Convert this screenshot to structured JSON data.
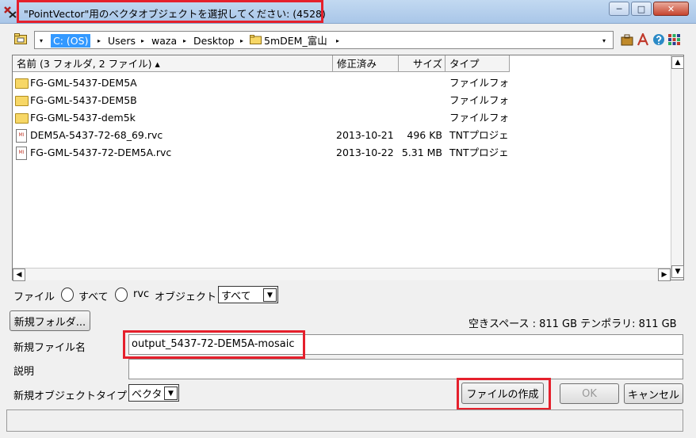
{
  "window": {
    "title": "\"PointVector\"用のベクタオブジェクトを選択してください: (4528)",
    "minimize_icon": "─",
    "maximize_icon": "□",
    "close_icon": "✕"
  },
  "address": {
    "crumbs": [
      "C: (OS)",
      "Users",
      "waza",
      "Desktop",
      "5mDEM_富山"
    ],
    "separator": "▸",
    "dropdown_icon": "▾"
  },
  "list": {
    "columns": {
      "name": "名前 (3 フォルダ, 2 ファイル) ▴",
      "modified": "修正済み",
      "size": "サイズ",
      "type": "タイプ"
    },
    "rows": [
      {
        "icon": "folder",
        "name": "FG-GML-5437-DEM5A",
        "modified": "",
        "size": "",
        "type": "ファイルフォ"
      },
      {
        "icon": "folder",
        "name": "FG-GML-5437-DEM5B",
        "modified": "",
        "size": "",
        "type": "ファイルフォ"
      },
      {
        "icon": "folder",
        "name": "FG-GML-5437-dem5k",
        "modified": "",
        "size": "",
        "type": "ファイルフォ"
      },
      {
        "icon": "rvc",
        "name": "DEM5A-5437-72-68_69.rvc",
        "modified": "2013-10-21",
        "size": "496 KB",
        "type": "TNTプロジェ"
      },
      {
        "icon": "rvc",
        "name": "FG-GML-5437-72-DEM5A.rvc",
        "modified": "2013-10-22",
        "size": "5.31 MB",
        "type": "TNTプロジェ"
      }
    ]
  },
  "filter": {
    "file_label": "ファイル",
    "option_all": "すべて",
    "option_rvc": "rvc",
    "object_label": "オブジェクト",
    "object_value": "すべて"
  },
  "new_folder_button": "新規フォルダ...",
  "space_info": "空きスペース : 811 GB   テンポラリ: 811 GB",
  "new_file_label": "新規ファイル名",
  "new_file_value": "output_5437-72-DEM5A-mosaic",
  "description_label": "説明",
  "description_value": "",
  "object_type_label": "新規オブジェクトタイプ",
  "object_type_value": "ベクタ",
  "buttons": {
    "create_file": "ファイルの作成",
    "ok": "OK",
    "cancel": "キャンセル"
  },
  "colors": {
    "highlight": "#e5202c",
    "selection": "#3399ff"
  }
}
